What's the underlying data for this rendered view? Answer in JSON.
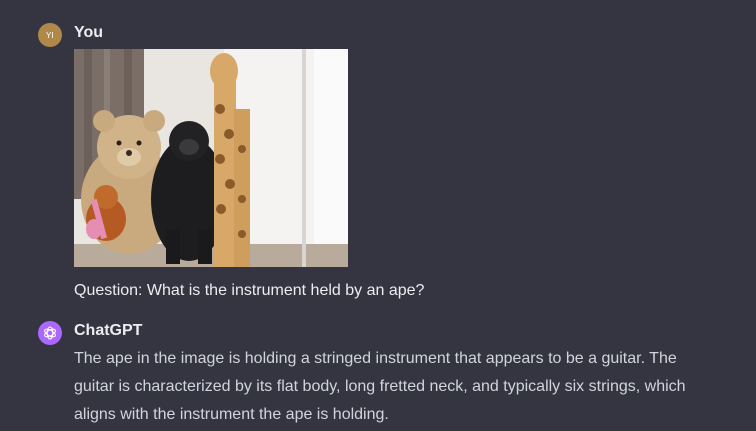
{
  "user": {
    "initials": "YI",
    "name": "You",
    "avatar_color": "#b0894a",
    "image_description_icon": "photo-toys-ape-giraffe-teddy",
    "question": "Question: What is the instrument held by an ape?"
  },
  "assistant": {
    "name": "ChatGPT",
    "avatar_color": "#ab68ff",
    "icon": "openai-logo-icon",
    "answer": "The ape in the image is holding a stringed instrument that appears to be a guitar. The guitar is characterized by its flat body, long fretted neck, and typically six strings, which aligns with the instrument the ape is holding."
  },
  "colors": {
    "background": "#343541",
    "text_primary": "#ececf1",
    "text_secondary": "#d1d5db"
  }
}
